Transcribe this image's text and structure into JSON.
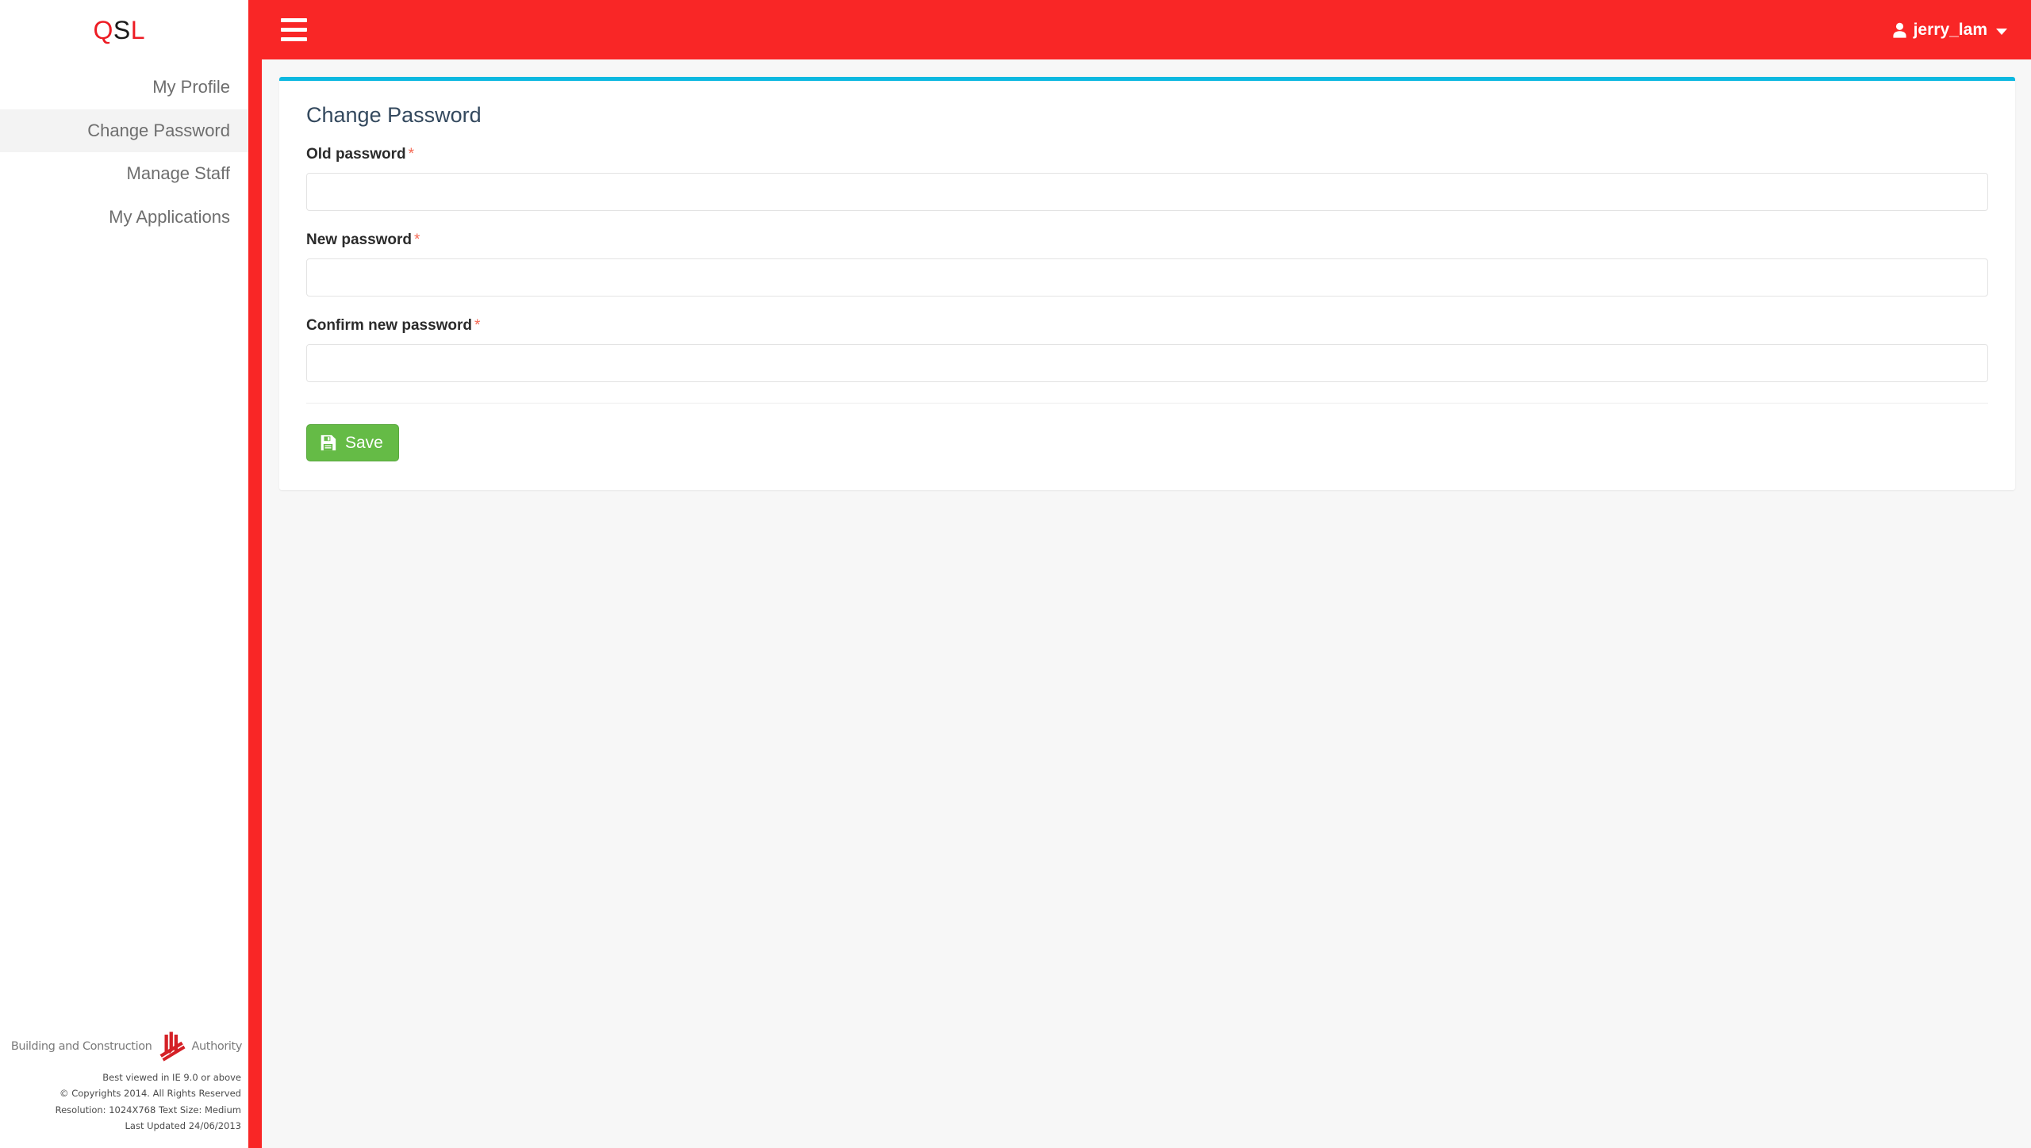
{
  "brand": {
    "logo_chars": [
      "Q",
      "S",
      "L"
    ],
    "logo_text": "QSL"
  },
  "sidebar": {
    "items": [
      {
        "label": "My Profile",
        "active": false
      },
      {
        "label": "Change Password",
        "active": true
      },
      {
        "label": "Manage Staff",
        "active": false
      },
      {
        "label": "My Applications",
        "active": false
      }
    ],
    "footer": {
      "org_prefix": "Building and Construction",
      "org_suffix": "Authority",
      "lines": [
        "Best viewed in IE 9.0 or above",
        "© Copyrights 2014. All Rights Reserved",
        "Resolution: 1024X768 Text Size: Medium",
        "Last Updated 24/06/2013"
      ]
    }
  },
  "topbar": {
    "menu_toggle_name": "hamburger-icon",
    "user": {
      "name": "jerry_lam",
      "icon": "user-icon",
      "caret": "caret-down-icon"
    }
  },
  "main": {
    "panel_title": "Change Password",
    "fields": [
      {
        "label": "Old password",
        "required_marker": "*",
        "value": "",
        "placeholder": "",
        "type": "password",
        "name": "old-password-input"
      },
      {
        "label": "New password",
        "required_marker": "*",
        "value": "",
        "placeholder": "",
        "type": "password",
        "name": "new-password-input"
      },
      {
        "label": "Confirm new password",
        "required_marker": "*",
        "value": "",
        "placeholder": "",
        "type": "password",
        "name": "confirm-new-password-input"
      }
    ],
    "save_button": {
      "label": "Save",
      "icon": "save-floppy-icon"
    }
  },
  "colors": {
    "brand_red": "#f92626",
    "logo_red": "#ed1c24",
    "panel_accent_cyan": "#0cb8e0",
    "save_green": "#65bb46",
    "required_red": "#f56954",
    "content_bg": "#f7f7f7",
    "sidebar_active_bg": "#f3f3f3",
    "nav_text": "#6e6e6e",
    "panel_title_text": "#34495e"
  }
}
